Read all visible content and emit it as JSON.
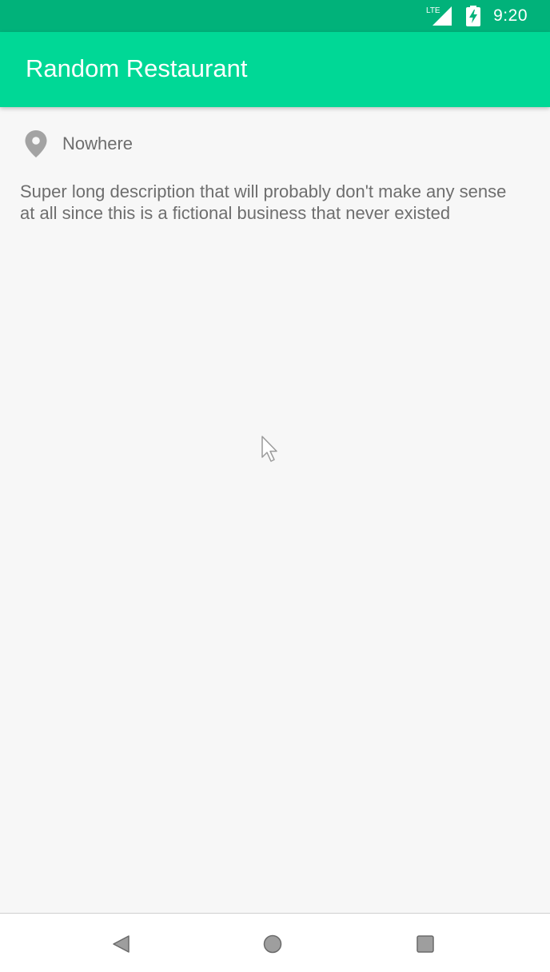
{
  "status_bar": {
    "network_icon": "lte-signal-icon",
    "network_label": "LTE",
    "battery_icon": "battery-charging-icon",
    "time": "9:20",
    "background_color": "#01b27a"
  },
  "app_bar": {
    "title": "Random Restaurant",
    "background_color": "#00d896"
  },
  "details": {
    "location_icon": "location-pin-icon",
    "location": "Nowhere",
    "description": "Super long description that will probably don't make any sense at all since this is a fictional business that never existed"
  },
  "nav_bar": {
    "back_icon": "back-triangle-icon",
    "home_icon": "home-circle-icon",
    "recents_icon": "recents-square-icon"
  }
}
